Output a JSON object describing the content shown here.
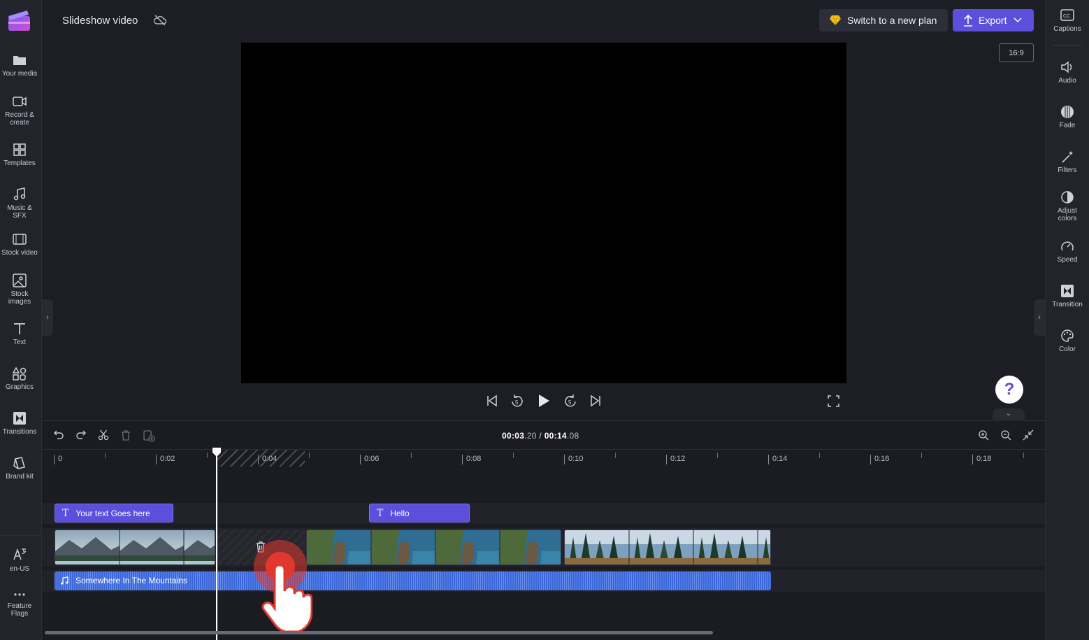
{
  "app": {
    "project_title": "Slideshow video"
  },
  "left_nav": [
    {
      "label": "Your media",
      "icon": "folder-icon"
    },
    {
      "label": "Record & create",
      "icon": "camera-icon"
    },
    {
      "label": "Templates",
      "icon": "templates-icon"
    },
    {
      "label": "Music & SFX",
      "icon": "music-icon"
    },
    {
      "label": "Stock video",
      "icon": "film-icon"
    },
    {
      "label": "Stock images",
      "icon": "image-icon"
    },
    {
      "label": "Text",
      "icon": "text-icon"
    },
    {
      "label": "Graphics",
      "icon": "shapes-icon"
    },
    {
      "label": "Transitions",
      "icon": "transitions-icon"
    },
    {
      "label": "Brand kit",
      "icon": "brand-kit-icon"
    },
    {
      "label": "en-US",
      "icon": "language-icon"
    },
    {
      "label": "Feature Flags",
      "icon": "more-icon"
    }
  ],
  "right_nav": [
    {
      "label": "Captions",
      "icon": "captions-icon"
    },
    {
      "label": "Audio",
      "icon": "speaker-icon"
    },
    {
      "label": "Fade",
      "icon": "fade-icon"
    },
    {
      "label": "Filters",
      "icon": "magic-wand-icon"
    },
    {
      "label": "Adjust colors",
      "icon": "contrast-icon"
    },
    {
      "label": "Speed",
      "icon": "speedometer-icon"
    },
    {
      "label": "Transition",
      "icon": "transition-icon"
    },
    {
      "label": "Color",
      "icon": "palette-icon"
    }
  ],
  "header": {
    "plan_button": "Switch to a new plan",
    "export_button": "Export",
    "aspect_ratio": "16:9"
  },
  "help": {
    "label": "?"
  },
  "timeline": {
    "current_time_main": "00:03",
    "current_time_ms": ".20",
    "separator": " / ",
    "total_time_main": "00:14",
    "total_time_ms": ".08",
    "ruler_labels": [
      "0",
      "0:02",
      "0:04",
      "0:06",
      "0:08",
      "0:10",
      "0:12",
      "0:14",
      "0:16",
      "0:18"
    ],
    "text_clips": [
      {
        "label": "Your text Goes here",
        "icon": "T"
      },
      {
        "label": "Hello",
        "icon": "T"
      }
    ],
    "audio_clip": {
      "label": "Somewhere In The Mountains"
    }
  }
}
